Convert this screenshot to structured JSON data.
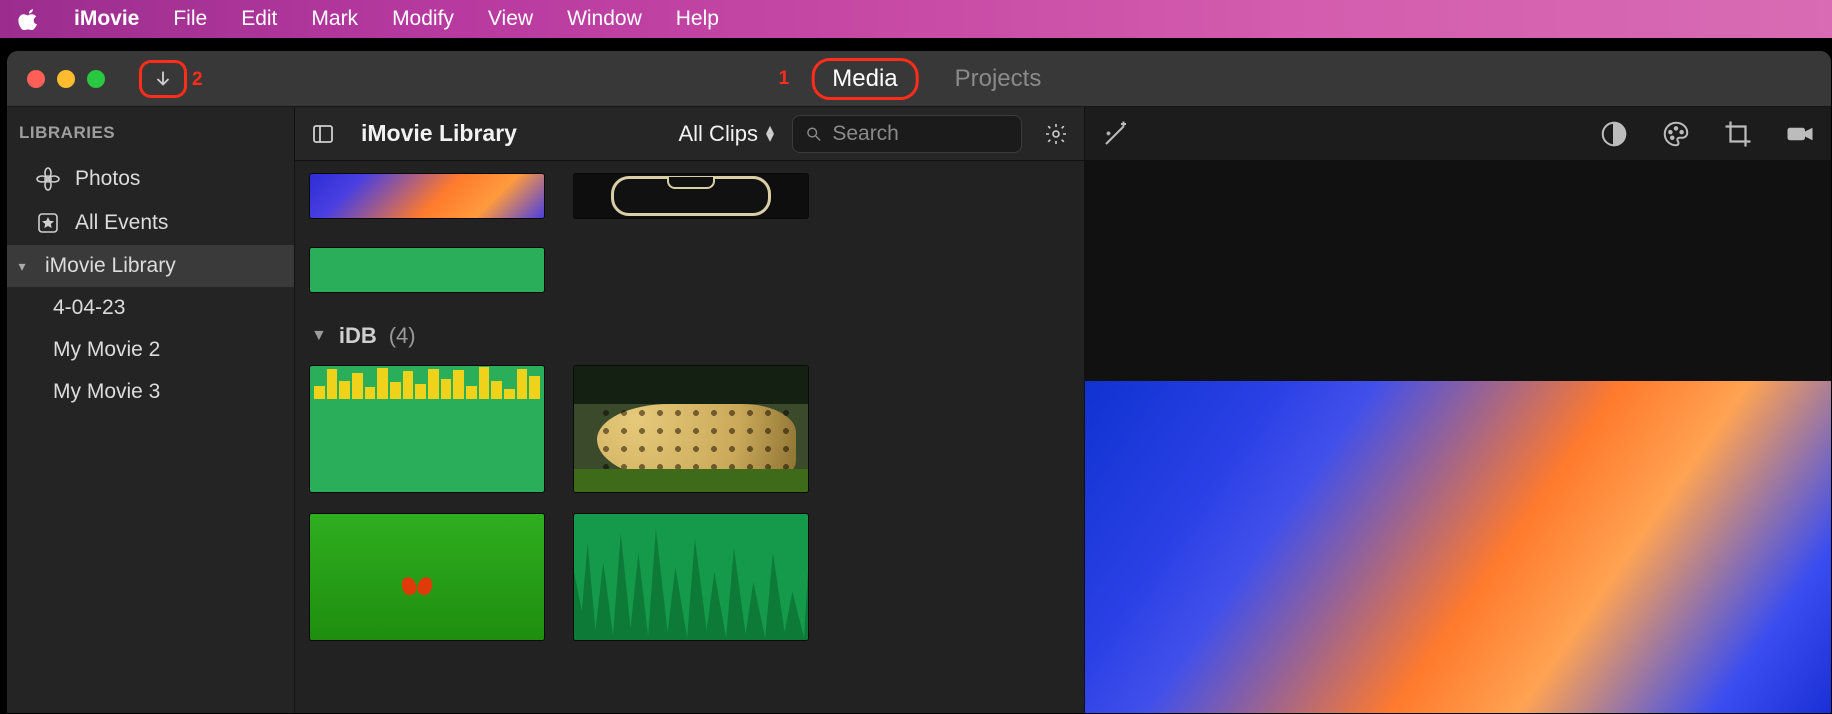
{
  "menubar": {
    "app": "iMovie",
    "items": [
      "File",
      "Edit",
      "Mark",
      "Modify",
      "View",
      "Window",
      "Help"
    ]
  },
  "titlebar": {
    "annotations": {
      "one": "1",
      "two": "2"
    },
    "tabs": {
      "media": "Media",
      "projects": "Projects"
    }
  },
  "sidebar": {
    "heading": "LIBRARIES",
    "photos": "Photos",
    "all_events": "All Events",
    "library_header": "iMovie Library",
    "events": [
      "4-04-23",
      "My Movie 2",
      "My Movie 3"
    ]
  },
  "browser": {
    "title": "iMovie Library",
    "filter": "All Clips",
    "search_placeholder": "Search",
    "group": {
      "name": "iDB",
      "count": "(4)"
    }
  },
  "icons": {
    "apple": "apple-logo",
    "import": "download-arrow",
    "sidebar_toggle": "sidebar-toggle",
    "search": "magnifier",
    "gear": "gear",
    "wand": "magic-wand",
    "contrast": "half-circle",
    "palette": "palette",
    "crop": "crop",
    "camera": "video-camera",
    "photos_app": "photos-flower",
    "star": "star-box"
  }
}
